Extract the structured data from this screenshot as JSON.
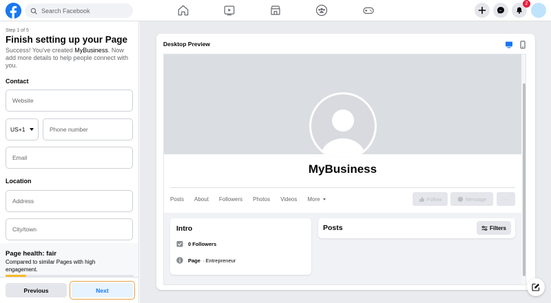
{
  "topbar": {
    "search_placeholder": "Search Facebook",
    "nav_icons": [
      "home-icon",
      "watch-icon",
      "marketplace-icon",
      "groups-icon",
      "gaming-icon"
    ],
    "notifications_badge": "2"
  },
  "setup": {
    "step": "Step 1 of 5",
    "title": "Finish setting up your Page",
    "desc_prefix": "Success! You've created ",
    "business_name": "MyBusiness",
    "desc_suffix": ". Now add more details to help people connect with you.",
    "contact_label": "Contact",
    "website_placeholder": "Website",
    "country_code": "US+1",
    "phone_placeholder": "Phone number",
    "email_placeholder": "Email",
    "location_label": "Location",
    "address_placeholder": "Address",
    "city_placeholder": "City/town"
  },
  "health": {
    "title": "Page health: fair",
    "desc": "Compared to similar Pages with high engagement.",
    "level": 0.16
  },
  "footer": {
    "previous": "Previous",
    "next": "Next"
  },
  "preview": {
    "title": "Desktop Preview",
    "page_name": "MyBusiness",
    "tabs": [
      "Posts",
      "About",
      "Followers",
      "Photos",
      "Videos"
    ],
    "more": "More",
    "follow": "Follow",
    "message": "Message",
    "more_actions": "···",
    "intro_title": "Intro",
    "followers_count": "0 Followers",
    "page_label": "Page",
    "page_category": "· Entrepreneur",
    "posts_title": "Posts",
    "filters": "Filters"
  },
  "colors": {
    "brand": "#1877f2",
    "health_bar": "#f7b928",
    "next_highlight": "#e7a040",
    "badge": "#e41e3f"
  }
}
